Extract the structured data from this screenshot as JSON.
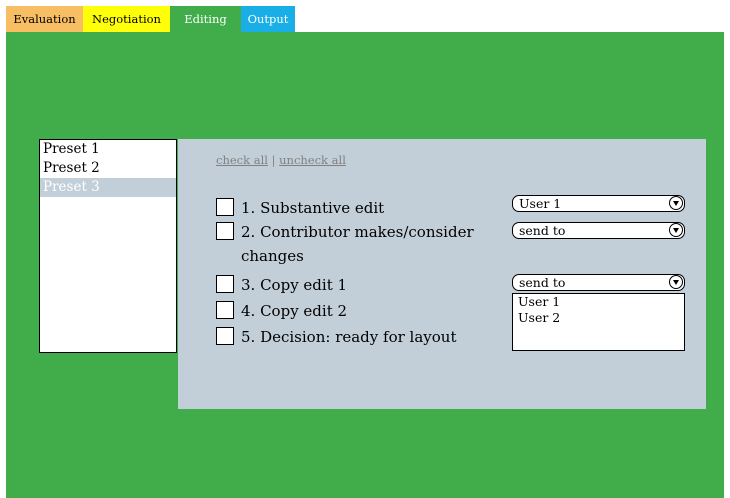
{
  "tabs": [
    {
      "label": "Evaluation"
    },
    {
      "label": "Negotiation"
    },
    {
      "label": "Editing"
    },
    {
      "label": "Output"
    }
  ],
  "presets": [
    {
      "label": "Preset 1"
    },
    {
      "label": "Preset 2"
    },
    {
      "label": "Preset 3",
      "selected": true
    }
  ],
  "links": {
    "check_all": "check all",
    "separator": "|",
    "uncheck_all": "uncheck all"
  },
  "steps": [
    {
      "label": "1. Substantive edit"
    },
    {
      "label": "2. Contributor makes/consider",
      "label_cont": "changes"
    },
    {
      "label": "3. Copy edit 1"
    },
    {
      "label": "4. Copy edit 2"
    },
    {
      "label": "5. Decision: ready for layout"
    }
  ],
  "selects": [
    {
      "value": "User 1"
    },
    {
      "value": "send to"
    },
    {
      "value": "send to"
    }
  ],
  "dropdown_options": [
    "User 1",
    "User 2"
  ],
  "colors": {
    "evaluation_tab": "#f8be63",
    "negotiation_tab": "#ffff0a",
    "editing_tab": "#41ad4a",
    "output_tab": "#1aaee6",
    "panel": "#c3cfd8"
  }
}
